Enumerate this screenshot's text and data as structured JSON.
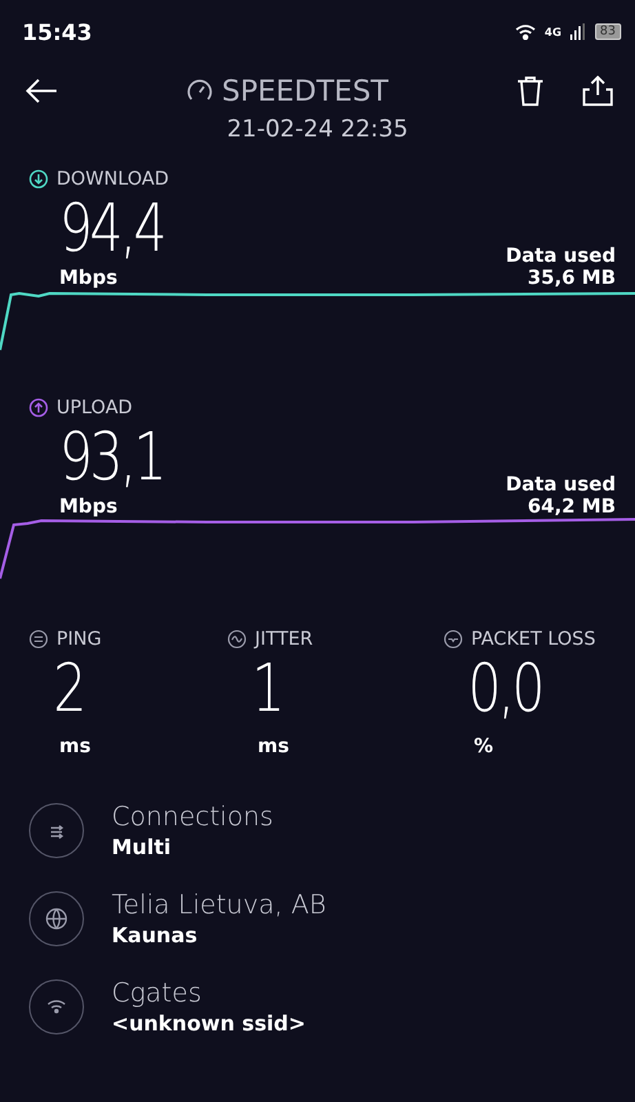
{
  "status_bar": {
    "time": "15:43",
    "network": "4G",
    "battery": "83"
  },
  "header": {
    "title": "SPEEDTEST",
    "date": "21-02-24 22:35"
  },
  "results": [
    {
      "kind": "download",
      "label": "DOWNLOAD",
      "value": "94,4",
      "unit": "Mbps",
      "data_label": "Data used",
      "data_value": "35,6 MB",
      "color": "#4fd8c4"
    },
    {
      "kind": "upload",
      "label": "UPLOAD",
      "value": "93,1",
      "unit": "Mbps",
      "data_label": "Data used",
      "data_value": "64,2 MB",
      "color": "#a55ee6"
    }
  ],
  "metrics": [
    {
      "kind": "ping",
      "label": "PING",
      "value": "2",
      "unit": "ms"
    },
    {
      "kind": "jitter",
      "label": "JITTER",
      "value": "1",
      "unit": "ms"
    },
    {
      "kind": "loss",
      "label": "PACKET LOSS",
      "value": "0,0",
      "unit": "%"
    }
  ],
  "info": [
    {
      "kind": "connections",
      "title": "Connections",
      "subtitle": "Multi"
    },
    {
      "kind": "provider",
      "title": "Telia Lietuva, AB",
      "subtitle": "Kaunas"
    },
    {
      "kind": "wifi",
      "title": "Cgates",
      "subtitle": "<unknown ssid>"
    }
  ]
}
